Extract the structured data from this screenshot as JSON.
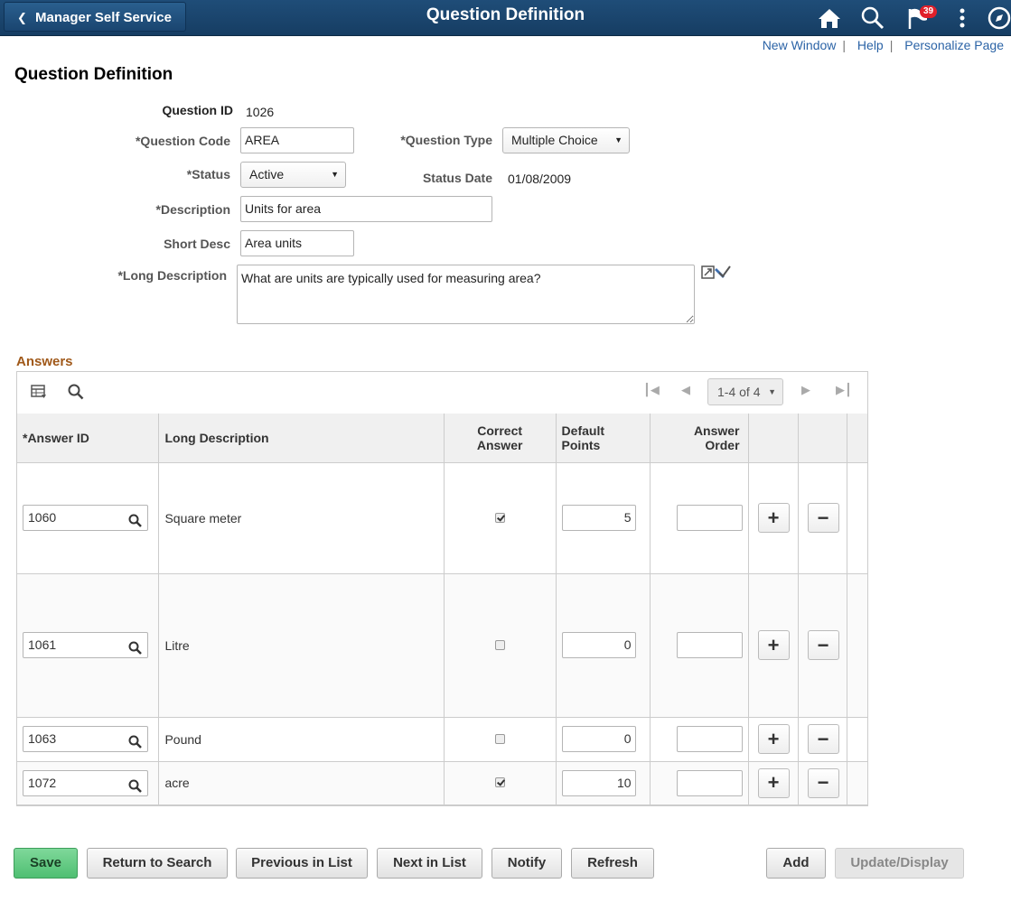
{
  "header": {
    "back_label": "Manager Self Service",
    "title": "Question Definition",
    "notification_count": "39"
  },
  "links": [
    "New Window",
    "Help",
    "Personalize Page"
  ],
  "page_title": "Question Definition",
  "form": {
    "question_id_label": "Question ID",
    "question_id": "1026",
    "question_code_label": "*Question Code",
    "question_code": "AREA",
    "question_type_label": "*Question Type",
    "question_type": "Multiple Choice",
    "status_label": "*Status",
    "status": "Active",
    "status_date_label": "Status Date",
    "status_date": "01/08/2009",
    "description_label": "*Description",
    "description": "Units for area",
    "short_desc_label": "Short Desc",
    "short_desc": "Area units",
    "long_description_label": "*Long Description",
    "long_description": "What are units are typically used for measuring area?"
  },
  "answers": {
    "section_title": "Answers",
    "pager": "1-4 of 4",
    "columns": {
      "answer_id": "*Answer ID",
      "long_description": "Long Description",
      "correct_answer_1": "Correct",
      "correct_answer_2": "Answer",
      "default_points_1": "Default",
      "default_points_2": "Points",
      "answer_order_1": "Answer",
      "answer_order_2": "Order"
    },
    "rows": [
      {
        "id": "1060",
        "desc": "Square meter",
        "correct": true,
        "points": "5",
        "order": ""
      },
      {
        "id": "1061",
        "desc": "Litre",
        "correct": false,
        "points": "0",
        "order": ""
      },
      {
        "id": "1063",
        "desc": "Pound",
        "correct": false,
        "points": "0",
        "order": ""
      },
      {
        "id": "1072",
        "desc": "acre",
        "correct": true,
        "points": "10",
        "order": ""
      }
    ]
  },
  "footer": {
    "save": "Save",
    "return_to_search": "Return to Search",
    "previous_in_list": "Previous in List",
    "next_in_list": "Next in List",
    "notify": "Notify",
    "refresh": "Refresh",
    "add": "Add",
    "update_display": "Update/Display"
  },
  "icons": [
    "home-icon",
    "search-icon",
    "flag-icon",
    "more-vertical-icon",
    "navbar-icon",
    "spell-check-icon",
    "grid-view-icon",
    "find-icon",
    "magnifier-icon",
    "plus-icon",
    "minus-icon"
  ]
}
